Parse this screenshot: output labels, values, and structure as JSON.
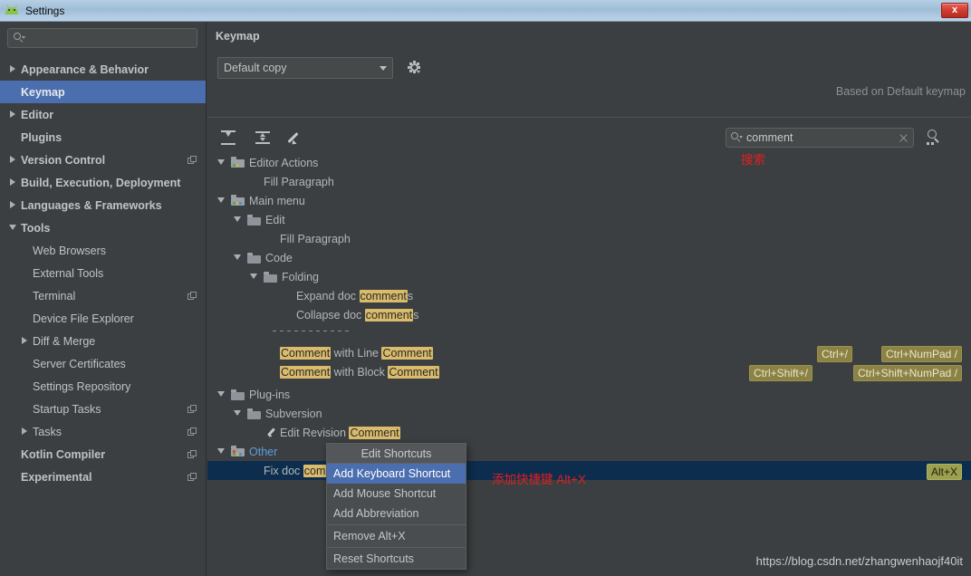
{
  "window": {
    "title": "Settings",
    "app_icon": "android-icon",
    "close_label": "x"
  },
  "sidebar": {
    "search_placeholder": "",
    "search_icon": "search-icon",
    "items": [
      {
        "label": "Appearance & Behavior",
        "level": 0,
        "arrow": "right",
        "selected": false,
        "copy_icon": false
      },
      {
        "label": "Keymap",
        "level": 0,
        "arrow": "none",
        "selected": true,
        "copy_icon": false
      },
      {
        "label": "Editor",
        "level": 0,
        "arrow": "right",
        "selected": false,
        "copy_icon": false
      },
      {
        "label": "Plugins",
        "level": 0,
        "arrow": "none",
        "selected": false,
        "copy_icon": false
      },
      {
        "label": "Version Control",
        "level": 0,
        "arrow": "right",
        "selected": false,
        "copy_icon": true
      },
      {
        "label": "Build, Execution, Deployment",
        "level": 0,
        "arrow": "right",
        "selected": false,
        "copy_icon": false
      },
      {
        "label": "Languages & Frameworks",
        "level": 0,
        "arrow": "right",
        "selected": false,
        "copy_icon": false
      },
      {
        "label": "Tools",
        "level": 0,
        "arrow": "down",
        "selected": false,
        "copy_icon": false
      },
      {
        "label": "Web Browsers",
        "level": 1,
        "arrow": "none",
        "selected": false,
        "copy_icon": false
      },
      {
        "label": "External Tools",
        "level": 1,
        "arrow": "none",
        "selected": false,
        "copy_icon": false
      },
      {
        "label": "Terminal",
        "level": 1,
        "arrow": "none",
        "selected": false,
        "copy_icon": true
      },
      {
        "label": "Device File Explorer",
        "level": 1,
        "arrow": "none",
        "selected": false,
        "copy_icon": false
      },
      {
        "label": "Diff & Merge",
        "level": 1,
        "arrow": "right",
        "selected": false,
        "copy_icon": false
      },
      {
        "label": "Server Certificates",
        "level": 1,
        "arrow": "none",
        "selected": false,
        "copy_icon": false
      },
      {
        "label": "Settings Repository",
        "level": 1,
        "arrow": "none",
        "selected": false,
        "copy_icon": false
      },
      {
        "label": "Startup Tasks",
        "level": 1,
        "arrow": "none",
        "selected": false,
        "copy_icon": true
      },
      {
        "label": "Tasks",
        "level": 1,
        "arrow": "right",
        "selected": false,
        "copy_icon": true
      },
      {
        "label": "Kotlin Compiler",
        "level": 0,
        "arrow": "none",
        "selected": false,
        "copy_icon": true
      },
      {
        "label": "Experimental",
        "level": 0,
        "arrow": "none",
        "selected": false,
        "copy_icon": true
      }
    ]
  },
  "main": {
    "panel_title": "Keymap",
    "keymap_value": "Default copy",
    "gear_icon": "gear-icon",
    "based_on": "Based on Default keymap",
    "toolbar": {
      "expand_all_icon": "expand-all-icon",
      "collapse_all_icon": "collapse-all-icon",
      "edit_icon": "pencil-icon"
    },
    "search": {
      "icon": "search-icon",
      "value": "comment",
      "clear_icon": "clear-icon",
      "shortcut_search_icon": "find-by-shortcut-icon"
    },
    "tree": [
      {
        "label": "Editor Actions",
        "highlight": "",
        "suffix": ""
      },
      {
        "label": "Fill Paragraph",
        "highlight": "",
        "suffix": ""
      },
      {
        "label": "Main menu",
        "highlight": "",
        "suffix": ""
      },
      {
        "label": "Edit",
        "highlight": "",
        "suffix": ""
      },
      {
        "label": "Fill Paragraph",
        "highlight": "",
        "suffix": ""
      },
      {
        "label": "Code",
        "highlight": "",
        "suffix": ""
      },
      {
        "label": "Folding",
        "highlight": "",
        "suffix": ""
      },
      {
        "label": "Expand doc ",
        "highlight": "comment",
        "suffix": "s"
      },
      {
        "label": "Collapse doc ",
        "highlight": "comment",
        "suffix": "s"
      },
      {
        "label": "Plug-ins",
        "highlight": "",
        "suffix": ""
      },
      {
        "label": "Subversion",
        "highlight": "",
        "suffix": ""
      },
      {
        "label": "Other",
        "highlight": "",
        "suffix": ""
      }
    ],
    "rows": {
      "editor_actions": "Editor Actions",
      "fill_paragraph_1": "Fill Paragraph",
      "main_menu": "Main menu",
      "edit": "Edit",
      "fill_paragraph_2": "Fill Paragraph",
      "code": "Code",
      "folding": "Folding",
      "expand_doc_pre": "Expand doc ",
      "expand_doc_hl": "comment",
      "expand_doc_post": "s",
      "collapse_doc_pre": "Collapse doc ",
      "collapse_doc_hl": "comment",
      "collapse_doc_post": "s",
      "comment_line_hl1": "Comment",
      "comment_line_mid": " with Line ",
      "comment_line_hl2": "Comment",
      "comment_block_hl1": "Comment",
      "comment_block_mid": " with Block ",
      "comment_block_hl2": "Comment",
      "plugins": "Plug-ins",
      "subversion": "Subversion",
      "edit_revision_pre": "Edit Revision ",
      "edit_revision_hl": "Comment",
      "other": "Other",
      "fix_doc_pre": "Fix doc ",
      "fix_doc_hl": "comment"
    },
    "shortcuts": {
      "ctrl_slash": "Ctrl+/",
      "ctrl_numpad_slash": "Ctrl+NumPad /",
      "ctrl_shift_slash": "Ctrl+Shift+/",
      "ctrl_shift_numpad_slash": "Ctrl+Shift+NumPad /",
      "alt_x": "Alt+X"
    }
  },
  "context_menu": {
    "header": "Edit Shortcuts",
    "items": [
      {
        "label": "Add Keyboard Shortcut",
        "active": true,
        "sep_after": false
      },
      {
        "label": "Add Mouse Shortcut",
        "active": false,
        "sep_after": false
      },
      {
        "label": "Add Abbreviation",
        "active": false,
        "sep_after": true
      },
      {
        "label": "Remove Alt+X",
        "active": false,
        "sep_after": true
      },
      {
        "label": "Reset Shortcuts",
        "active": false,
        "sep_after": false
      }
    ]
  },
  "annotations": {
    "search_note": "搜索",
    "add_shortcut_note": "添加快捷键 Alt+X",
    "watermark": "https://blog.csdn.net/zhangwenhaojf40it"
  },
  "colors": {
    "background": "#3c3f41",
    "selection_blue": "#4b6eaf",
    "tree_selection": "#0d2d4e",
    "highlight_amber": "#d9bb6b",
    "shortcut_badge": "#8c8243",
    "link_blue": "#5c9fe0",
    "annotation_red": "#e02020"
  }
}
